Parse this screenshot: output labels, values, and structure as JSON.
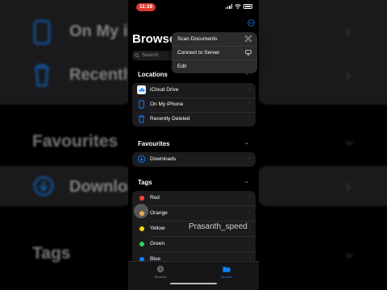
{
  "status": {
    "time": "11:39"
  },
  "page": {
    "title": "Browse"
  },
  "search": {
    "placeholder": "Search"
  },
  "menu": {
    "items": [
      {
        "label": "Scan Documents",
        "icon": "scan-icon"
      },
      {
        "label": "Connect to Server",
        "icon": "monitor-icon"
      },
      {
        "label": "Edit"
      }
    ]
  },
  "locations": {
    "title": "Locations",
    "items": [
      {
        "label": "iCloud Drive",
        "icon": "cloud-icon"
      },
      {
        "label": "On My iPhone",
        "icon": "phone-icon"
      },
      {
        "label": "Recently Deleted",
        "icon": "trash-icon"
      }
    ]
  },
  "favourites": {
    "title": "Favourites",
    "items": [
      {
        "label": "Downloads",
        "icon": "download-icon"
      }
    ]
  },
  "tags": {
    "title": "Tags",
    "items": [
      {
        "label": "Red",
        "color": "#ff453a"
      },
      {
        "label": "Orange",
        "color": "#ff9f0a"
      },
      {
        "label": "Yellow",
        "color": "#ffd60a"
      },
      {
        "label": "Green",
        "color": "#30d158"
      },
      {
        "label": "Blue",
        "color": "#0a84ff"
      }
    ]
  },
  "tabbar": {
    "recents": "Recents",
    "browse": "Browse"
  },
  "watermark": "Prasanth_speed",
  "background": {
    "on_my": "On My iP",
    "recently": "Recently",
    "favourites": "Favourites",
    "downloads": "Downloa",
    "tags": "Tags"
  },
  "colors": {
    "accent": "#0a84ff",
    "time_pill": "#e0372f",
    "card": "#1c1c1e"
  }
}
